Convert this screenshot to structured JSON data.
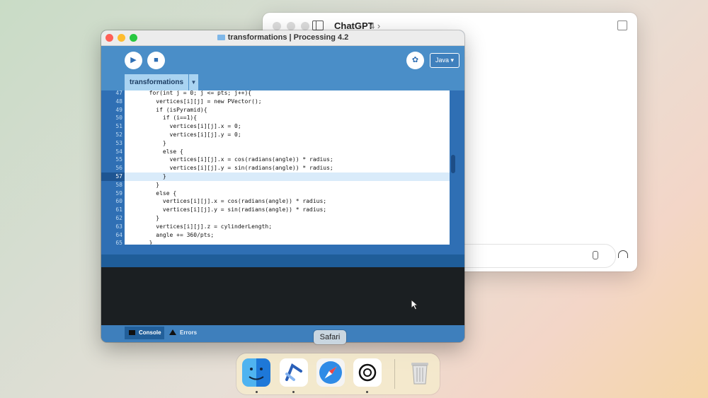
{
  "chatgpt_window": {
    "title": "ChatGPT",
    "model": "4",
    "model_chevron": "›"
  },
  "processing_window": {
    "title": "transformations | Processing 4.2",
    "run_icon": "▶",
    "stop_icon": "■",
    "debug_icon": "✿",
    "mode": "Java ▾",
    "tab": "transformations",
    "tab_menu": "▼",
    "code_lines": [
      {
        "n": "47",
        "text": "  for(int j = 0; j <= pts; j++){"
      },
      {
        "n": "48",
        "text": "    vertices[i][j] = new PVector();"
      },
      {
        "n": "49",
        "text": "    if (isPyramid){"
      },
      {
        "n": "50",
        "text": "      if (i==1){"
      },
      {
        "n": "51",
        "text": "        vertices[i][j].x = 0;"
      },
      {
        "n": "52",
        "text": "        vertices[i][j].y = 0;"
      },
      {
        "n": "53",
        "text": "      }"
      },
      {
        "n": "54",
        "text": "      else {"
      },
      {
        "n": "55",
        "text": "        vertices[i][j].x = cos(radians(angle)) * radius;"
      },
      {
        "n": "56",
        "text": "        vertices[i][j].y = sin(radians(angle)) * radius;"
      },
      {
        "n": "57",
        "text": "      }"
      },
      {
        "n": "58",
        "text": "    }"
      },
      {
        "n": "59",
        "text": "    else {"
      },
      {
        "n": "60",
        "text": "      vertices[i][j].x = cos(radians(angle)) * radius;"
      },
      {
        "n": "61",
        "text": "      vertices[i][j].y = sin(radians(angle)) * radius;"
      },
      {
        "n": "62",
        "text": "    }"
      },
      {
        "n": "63",
        "text": "    vertices[i][j].z = cylinderLength;"
      },
      {
        "n": "64",
        "text": "    angle += 360/pts;"
      },
      {
        "n": "65",
        "text": "  }"
      }
    ],
    "current_line": "57",
    "console_tab": "Console",
    "errors_tab": "Errors"
  },
  "dock": {
    "tooltip": "Safari",
    "apps": [
      {
        "name": "Finder",
        "icon": "finder-icon",
        "running": true
      },
      {
        "name": "Processing",
        "icon": "processing-icon",
        "running": true
      },
      {
        "name": "Safari",
        "icon": "safari-icon",
        "running": false
      },
      {
        "name": "ChatGPT",
        "icon": "chatgpt-icon",
        "running": true
      },
      {
        "name": "Trash",
        "icon": "trash-icon",
        "running": false
      }
    ]
  },
  "colors": {
    "processing_blue": "#2f6fb4",
    "editor_bg": "#ffffff",
    "console_bg": "#1b1f22",
    "current_line_highlight": "#d9ebfa"
  }
}
